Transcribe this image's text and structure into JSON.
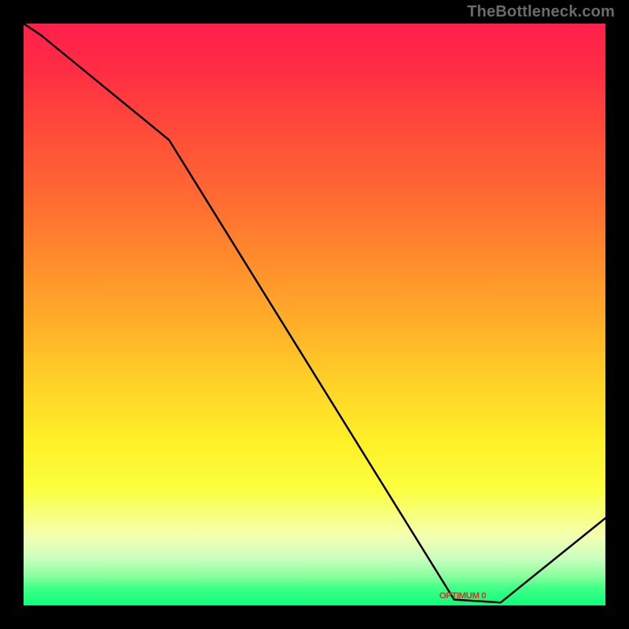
{
  "watermark": "TheBottleneck.com",
  "plateau_label": "OPTIMUM 0",
  "chart_data": {
    "type": "line",
    "title": "",
    "xlabel": "",
    "ylabel": "",
    "xlim": [
      0,
      100
    ],
    "ylim": [
      0,
      100
    ],
    "x": [
      0,
      3,
      25,
      74,
      82,
      100
    ],
    "values": [
      100,
      98,
      80,
      1,
      0.5,
      15
    ],
    "background_gradient": {
      "top": "#ff1f4b",
      "mid": "#fff028",
      "bottom": "#0cff7c"
    },
    "annotations": [
      {
        "text": "OPTIMUM 0",
        "x": 78,
        "y": 1,
        "color": "#cc3b2b"
      }
    ]
  }
}
